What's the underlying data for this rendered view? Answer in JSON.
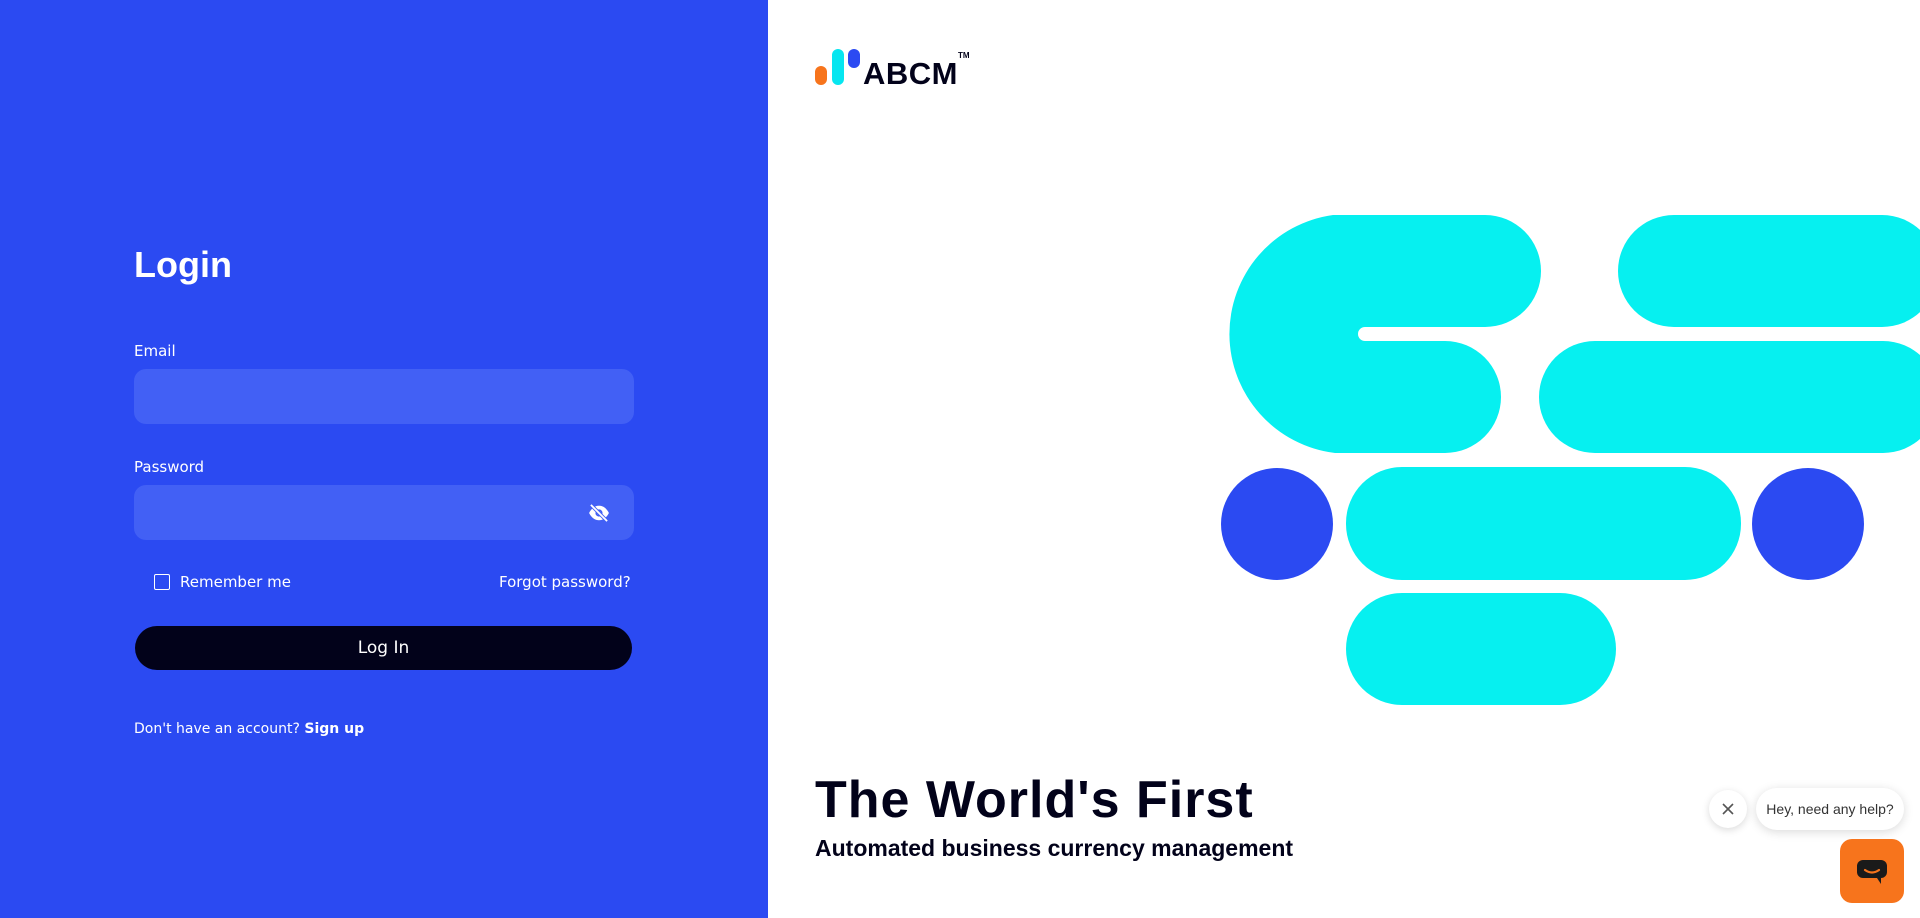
{
  "login": {
    "title": "Login",
    "email_label": "Email",
    "email_value": "",
    "password_label": "Password",
    "password_value": "",
    "remember_label": "Remember me",
    "forgot_label": "Forgot password?",
    "login_button": "Log In",
    "signup_prompt": "Don't have an account?",
    "signup_link": "Sign up"
  },
  "brand": {
    "name": "ABCM",
    "trademark": "TM",
    "headline": "The World's First",
    "subheadline": "Automated business currency management"
  },
  "chat": {
    "message": "Hey, need any help?"
  },
  "colors": {
    "primary_blue": "#2b4af2",
    "input_blue": "#4260f5",
    "cyan": "#06f0f0",
    "dark": "#02021a",
    "orange": "#f7741c"
  },
  "icons": [
    "eye-off-icon",
    "close-icon",
    "chat-icon",
    "logo-mark"
  ]
}
